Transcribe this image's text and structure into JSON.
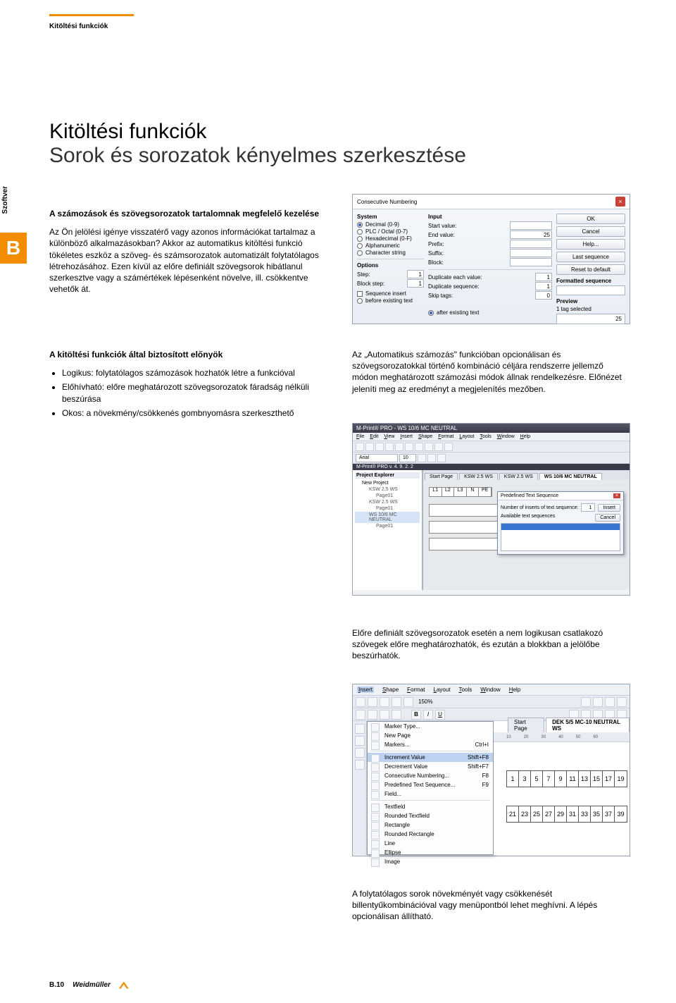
{
  "page": {
    "header_label": "Kitöltési funkciók",
    "side_tab": "Szoftver",
    "side_letter": "B",
    "title_1": "Kitöltési funkciók",
    "title_2": "Sorok és sorozatok kényelmes szerkesztése",
    "lead": "A számozások és szövegsorozatok tartalomnak megfelelő kezelése",
    "body_para": "Az Ön jelölési igénye visszatérő vagy azonos információkat tartalmaz a különböző alkalmazásokban? Akkor az automatikus kitöltési funkció tökéletes eszköz a szöveg- és számsorozatok automatizált folytatólagos létrehozásához. Ezen kívül az előre definiált szövegsorok hibátlanul szerkesztve vagy a számértékek lépésenként növelve, ill. csökkentve vehetők át.",
    "benefits_head": "A kitöltési funkciók által biztosított előnyök",
    "benefits": [
      "Logikus: folytatólagos számozások hozhatók létre a funkcióval",
      "Előhívható: előre meghatározott szövegsorozatok fáradság nélküli beszúrása",
      "Okos: a növekmény/csökkenés gombnyomásra szerkeszthető"
    ],
    "right_para_1": "Az „Automatikus számozás\" funkcióban opcionálisan és szövegsorozatokkal történő kombináció céljára rendszerre jellemző módon meghatározott számozási módok állnak rendelkezésre. Előnézet jeleníti meg az eredményt a megjelenítés mezőben.",
    "right_para_2": "Előre definiált szövegsorozatok esetén a nem logikusan csatlakozó szövegek előre meghatározhatók, és ezután a blokkban a jelölőbe beszúrhatók.",
    "right_para_3": "A folytatólagos sorok növekményét vagy csökkenését billentyűkombinációval vagy menüpontból lehet meghívni. A lépés opcionálisan állítható.",
    "page_num": "B.10",
    "brand": "Weidmüller"
  },
  "shot1": {
    "title": "Consecutive Numbering",
    "sections": {
      "system": "System",
      "input": "Input",
      "options": "Options",
      "formatted": "Formatted sequence",
      "preview_h": "Preview"
    },
    "system_options": [
      "Decimal (0-9)",
      "PLC / Octal (0-7)",
      "Hexadecimal (0-F)",
      "Alphanumeric",
      "Character string"
    ],
    "system_selected": 0,
    "input_labels": {
      "start": "Start value:",
      "end": "End value:",
      "prefix": "Prefix:",
      "suffix": "Suffix:",
      "block": "Block:"
    },
    "input_values": {
      "end": "25"
    },
    "opt_labels": {
      "step": "Step:",
      "blockstep": "Block step:",
      "dup_each": "Duplicate each value:",
      "dup_seq": "Duplicate sequence:",
      "skip": "Skip tags:"
    },
    "opt_values": {
      "step": "1",
      "blockstep": "1",
      "dup_each": "1",
      "dup_seq": "1",
      "skip": "0"
    },
    "seq_insert": "Sequence insert",
    "before": "before existing text",
    "after": "after existing text",
    "buttons": [
      "OK",
      "Cancel",
      "Help...",
      "Last sequence",
      "Reset to default"
    ],
    "preview_label": "1 tag selected",
    "preview_value": "25"
  },
  "shot2": {
    "titlebar": "M-Print® PRO - WS 10/6 MC NEUTRAL",
    "menus": [
      "File",
      "Edit",
      "View",
      "Insert",
      "Shape",
      "Format",
      "Layout",
      "Tools",
      "Window",
      "Help"
    ],
    "font": "Arial",
    "fontsize": "10",
    "version": "M-Print® PRO v. 4. 9. 2. 2",
    "explorer_head": "Project Explorer",
    "tree": [
      "New Project",
      "KSW 2.5 WS",
      "Page01",
      "KSW 2.5 WS",
      "Page01",
      "WS 10/6 MC NEUTRAL",
      "Page01"
    ],
    "tabs": [
      "Start Page",
      "KSW 2.5 WS",
      "KSW 2.5 WS",
      "WS 10/6 MC NEUTRAL"
    ],
    "strip_cells": [
      "L1",
      "L2",
      "L3",
      "N",
      "PE"
    ],
    "dlg": {
      "title": "Predefined Text Sequence",
      "label": "Number of inserts of text sequence:",
      "value": "1",
      "avail": "Available text sequences",
      "insert": "Insert",
      "cancel": "Cancel"
    }
  },
  "shot3": {
    "menus": [
      "Insert",
      "Shape",
      "Format",
      "Layout",
      "Tools",
      "Window",
      "Help"
    ],
    "zoom": "150%",
    "menu_items": [
      {
        "label": "Marker Type...",
        "sc": ""
      },
      {
        "label": "New Page",
        "sc": ""
      },
      {
        "label": "Markers...",
        "sc": "Ctrl+I"
      },
      {
        "sep": true
      },
      {
        "label": "Increment Value",
        "sc": "Shift+F8",
        "hl": true
      },
      {
        "label": "Decrement Value",
        "sc": "Shift+F7"
      },
      {
        "label": "Consecutive Numbering...",
        "sc": "F8"
      },
      {
        "label": "Predefined Text Sequence...",
        "sc": "F9"
      },
      {
        "label": "Field...",
        "sc": ""
      },
      {
        "sep": true
      },
      {
        "label": "Textfield",
        "sc": ""
      },
      {
        "label": "Rounded Textfield",
        "sc": ""
      },
      {
        "label": "Rectangle",
        "sc": ""
      },
      {
        "label": "Rounded Rectangle",
        "sc": ""
      },
      {
        "label": "Line",
        "sc": ""
      },
      {
        "label": "Ellipse",
        "sc": ""
      },
      {
        "label": "Image",
        "sc": ""
      }
    ],
    "tabs": [
      "Start Page",
      "DEK 5/5 MC-10 NEUTRAL WS"
    ],
    "ruler_ticks": [
      "10",
      "20",
      "30",
      "40",
      "50",
      "60"
    ],
    "strip1": [
      "1",
      "3",
      "5",
      "7",
      "9",
      "11",
      "13",
      "15",
      "17",
      "19"
    ],
    "strip2": [
      "21",
      "23",
      "25",
      "27",
      "29",
      "31",
      "33",
      "35",
      "37",
      "39"
    ]
  }
}
